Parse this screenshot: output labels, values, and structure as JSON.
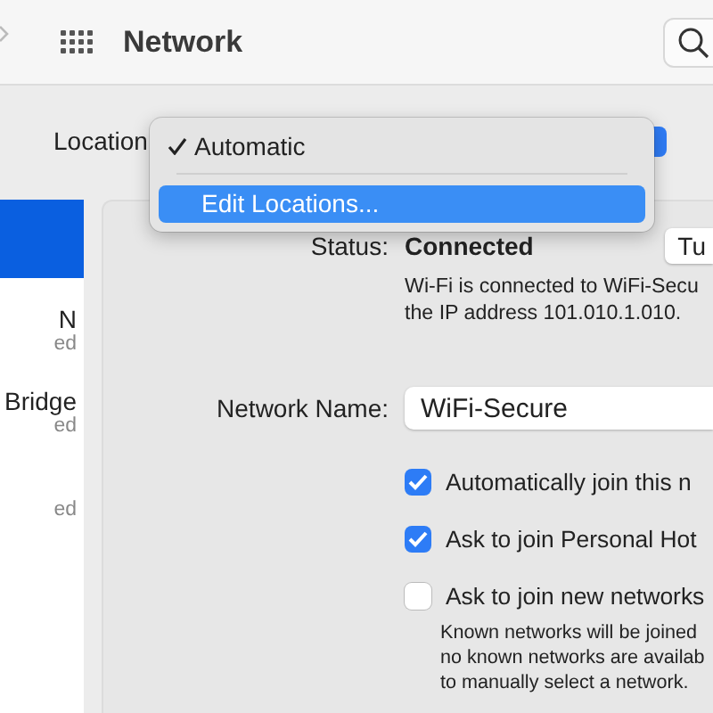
{
  "toolbar": {
    "title": "Network"
  },
  "location": {
    "label": "Location",
    "menu": [
      {
        "kind": "option",
        "label": "Automatic",
        "checked": true,
        "highlighted": false
      },
      {
        "kind": "separator"
      },
      {
        "kind": "option",
        "label": "Edit Locations...",
        "checked": false,
        "highlighted": true
      }
    ]
  },
  "sidebar": {
    "items": [
      {
        "selected": true
      },
      {
        "name": "N",
        "status": "ed",
        "selected": false
      },
      {
        "name": "Bridge",
        "status": "ed",
        "selected": false
      },
      {
        "status": "ed",
        "selected": false
      }
    ]
  },
  "details": {
    "status_label": "Status:",
    "status_value": "Connected",
    "button": "Tu",
    "description": [
      "Wi-Fi is connected to WiFi-Secu",
      "the IP address 101.010.1.010."
    ],
    "network_name_label": "Network Name:",
    "network_name": "WiFi-Secure",
    "options": [
      {
        "label": "Automatically join this n",
        "checked": true
      },
      {
        "label": "Ask to join Personal Hot",
        "checked": true
      },
      {
        "label": "Ask to join new networks",
        "checked": false
      }
    ],
    "note": [
      "Known networks will be joined",
      "no known networks are availab",
      "to manually select a network."
    ]
  }
}
